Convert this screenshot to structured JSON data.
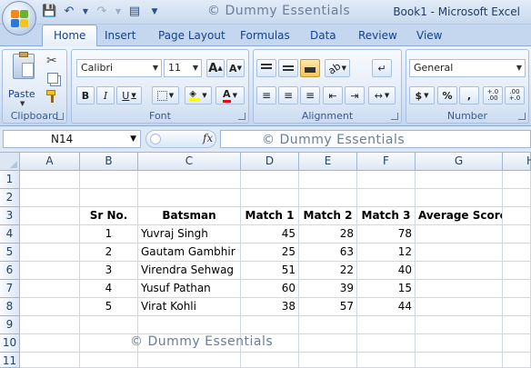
{
  "window": {
    "title": "Book1 - Microsoft Excel",
    "watermark": "© Dummy Essentials"
  },
  "tabs": [
    "Home",
    "Insert",
    "Page Layout",
    "Formulas",
    "Data",
    "Review",
    "View"
  ],
  "ribbon": {
    "clipboard": {
      "label": "Clipboard",
      "paste_label": "Paste"
    },
    "font": {
      "label": "Font",
      "font_name": "Calibri",
      "font_size": "11",
      "bold": "B",
      "italic": "I",
      "underline": "U",
      "grow": "A",
      "shrink": "A",
      "color_a": "A"
    },
    "alignment": {
      "label": "Alignment"
    },
    "number": {
      "label": "Number",
      "format": "General",
      "currency": "$",
      "percent": "%",
      "comma": ",",
      "inc_decimal": "+.0\n.00",
      "dec_decimal": ".00\n+.0"
    }
  },
  "formula_bar": {
    "name_box": "N14",
    "fx": "fx",
    "formula": ""
  },
  "sheet": {
    "columns": [
      "A",
      "B",
      "C",
      "D",
      "E",
      "F",
      "G",
      "H"
    ],
    "rows": [
      "1",
      "2",
      "3",
      "4",
      "5",
      "6",
      "7",
      "8",
      "9",
      "10",
      "11"
    ],
    "headers": {
      "sr": "Sr No.",
      "batsman": "Batsman",
      "m1": "Match 1",
      "m2": "Match 2",
      "m3": "Match 3",
      "avg": "Average Score"
    },
    "data": [
      {
        "sr": "1",
        "batsman": "Yuvraj Singh",
        "m1": "45",
        "m2": "28",
        "m3": "78"
      },
      {
        "sr": "2",
        "batsman": "Gautam Gambhir",
        "m1": "25",
        "m2": "63",
        "m3": "12"
      },
      {
        "sr": "3",
        "batsman": "Virendra Sehwag",
        "m1": "51",
        "m2": "22",
        "m3": "40"
      },
      {
        "sr": "4",
        "batsman": "Yusuf Pathan",
        "m1": "60",
        "m2": "39",
        "m3": "15"
      },
      {
        "sr": "5",
        "batsman": "Virat Kohli",
        "m1": "38",
        "m2": "57",
        "m3": "44"
      }
    ]
  },
  "colors": {
    "ribbon_blue": "#c4d7ef",
    "text_blue": "#15428b",
    "grid_line": "#d0d7e5"
  }
}
